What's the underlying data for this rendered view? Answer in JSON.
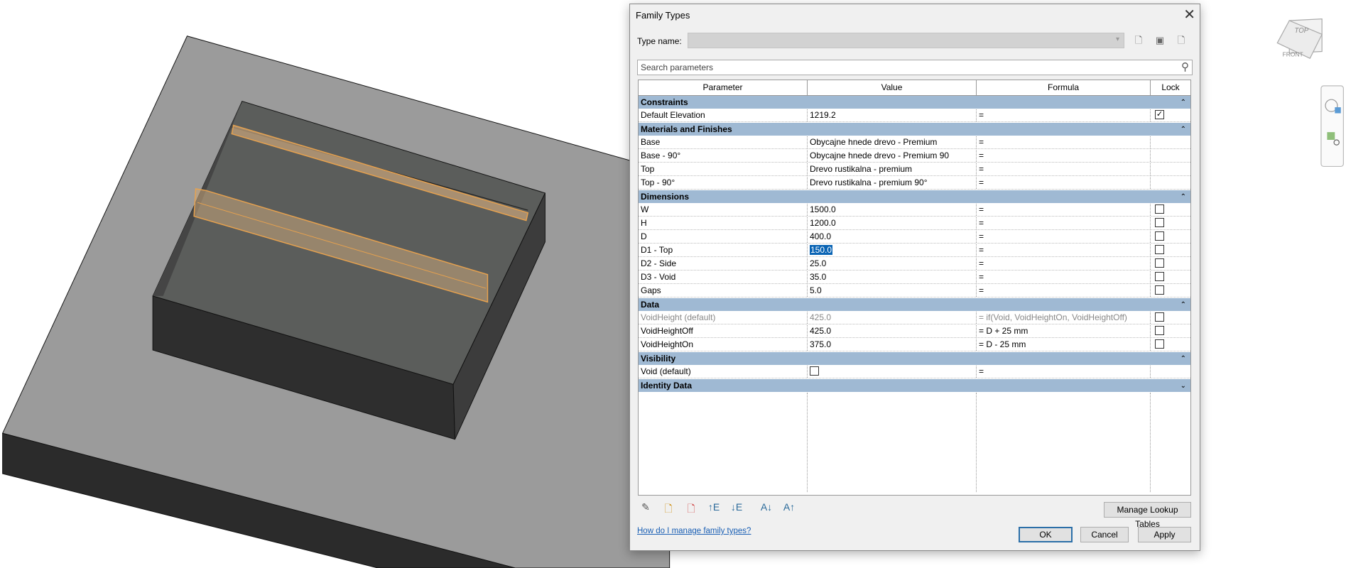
{
  "dialog": {
    "title": "Family Types",
    "type_name_label": "Type name:",
    "type_name_value": "",
    "search_placeholder": "Search parameters",
    "columns": [
      "Parameter",
      "Value",
      "Formula",
      "Lock"
    ],
    "groups": [
      {
        "name": "Constraints",
        "expanded": true,
        "rows": [
          {
            "param": "Default Elevation",
            "value": "1219.2",
            "formula": "=",
            "lock": true
          }
        ]
      },
      {
        "name": "Materials and Finishes",
        "expanded": true,
        "rows": [
          {
            "param": "Base",
            "value": "Obycajne hnede drevo - Premium",
            "formula": "=",
            "lock": null
          },
          {
            "param": "Base - 90°",
            "value": "Obycajne hnede drevo - Premium 90",
            "formula": "=",
            "lock": null
          },
          {
            "param": "Top",
            "value": "Drevo rustikalna - premium",
            "formula": "=",
            "lock": null
          },
          {
            "param": "Top - 90°",
            "value": "Drevo rustikalna - premium 90°",
            "formula": "=",
            "lock": null
          }
        ]
      },
      {
        "name": "Dimensions",
        "expanded": true,
        "rows": [
          {
            "param": "W",
            "value": "1500.0",
            "formula": "=",
            "lock": false
          },
          {
            "param": "H",
            "value": "1200.0",
            "formula": "=",
            "lock": false
          },
          {
            "param": "D",
            "value": "400.0",
            "formula": "=",
            "lock": false
          },
          {
            "param": "D1 - Top",
            "value": "150.0",
            "formula": "=",
            "lock": false,
            "selected": true
          },
          {
            "param": "D2 - Side",
            "value": "25.0",
            "formula": "=",
            "lock": false
          },
          {
            "param": "D3 - Void",
            "value": "35.0",
            "formula": "=",
            "lock": false
          },
          {
            "param": "Gaps",
            "value": "5.0",
            "formula": "=",
            "lock": false
          }
        ]
      },
      {
        "name": "Data",
        "expanded": true,
        "rows": [
          {
            "param": "VoidHeight (default)",
            "value": "425.0",
            "formula": "= if(Void, VoidHeightOn, VoidHeightOff)",
            "lock": false,
            "disabled": true
          },
          {
            "param": "VoidHeightOff",
            "value": "425.0",
            "formula": "= D + 25 mm",
            "lock": false
          },
          {
            "param": "VoidHeightOn",
            "value": "375.0",
            "formula": "= D - 25 mm",
            "lock": false
          }
        ]
      },
      {
        "name": "Visibility",
        "expanded": true,
        "rows": [
          {
            "param": "Void (default)",
            "value": "",
            "value_checkbox": false,
            "formula": "=",
            "lock": null
          }
        ]
      },
      {
        "name": "Identity Data",
        "expanded": false,
        "rows": []
      }
    ],
    "manage_lookup_label": "Manage Lookup Tables",
    "help_link": "How do I manage family types?",
    "ok_label": "OK",
    "cancel_label": "Cancel",
    "apply_label": "Apply"
  },
  "viewcube": {
    "top": "TOP",
    "front": "FRONT"
  },
  "colors": {
    "group_header": "#9fb9d3",
    "selection": "#0a64b4",
    "highlight": "#e8a24e"
  }
}
